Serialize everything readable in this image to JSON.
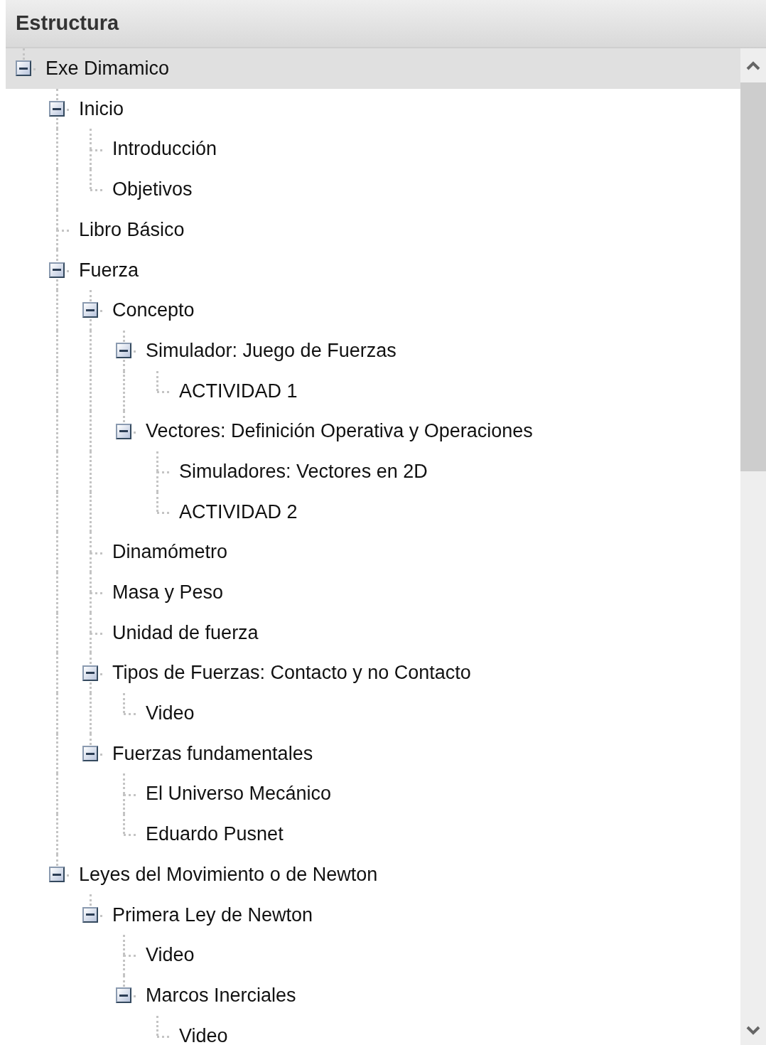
{
  "header": {
    "title": "Estructura"
  },
  "tree": [
    {
      "label": "Exe Dimamico",
      "selected": true,
      "expanded": true,
      "children": [
        {
          "label": "Inicio",
          "selected": false,
          "expanded": true,
          "children": [
            {
              "label": "Introducción",
              "selected": false
            },
            {
              "label": "Objetivos",
              "selected": false
            }
          ]
        },
        {
          "label": "Libro Básico",
          "selected": false
        },
        {
          "label": "Fuerza",
          "selected": false,
          "expanded": true,
          "children": [
            {
              "label": "Concepto",
              "selected": false,
              "expanded": true,
              "children": [
                {
                  "label": "Simulador: Juego de Fuerzas",
                  "selected": false,
                  "expanded": true,
                  "children": [
                    {
                      "label": "ACTIVIDAD 1",
                      "selected": false
                    }
                  ]
                },
                {
                  "label": "Vectores: Definición Operativa y Operaciones",
                  "selected": false,
                  "expanded": true,
                  "children": [
                    {
                      "label": "Simuladores: Vectores en 2D",
                      "selected": false
                    },
                    {
                      "label": "ACTIVIDAD 2",
                      "selected": false
                    }
                  ]
                }
              ]
            },
            {
              "label": "Dinamómetro",
              "selected": false
            },
            {
              "label": "Masa y Peso",
              "selected": false
            },
            {
              "label": "Unidad de fuerza",
              "selected": false
            },
            {
              "label": "Tipos de Fuerzas: Contacto y no Contacto",
              "selected": false,
              "expanded": true,
              "children": [
                {
                  "label": "Video",
                  "selected": false
                }
              ]
            },
            {
              "label": "Fuerzas fundamentales",
              "selected": false,
              "expanded": true,
              "children": [
                {
                  "label": "El Universo Mecánico",
                  "selected": false
                },
                {
                  "label": "Eduardo Pusnet",
                  "selected": false
                }
              ]
            }
          ]
        },
        {
          "label": "Leyes del Movimiento o de Newton",
          "selected": false,
          "expanded": true,
          "children": [
            {
              "label": "Primera Ley de Newton",
              "selected": false,
              "expanded": true,
              "children": [
                {
                  "label": "Video",
                  "selected": false
                },
                {
                  "label": "Marcos Inerciales",
                  "selected": false,
                  "expanded": true,
                  "children": [
                    {
                      "label": "Video",
                      "selected": false
                    }
                  ]
                }
              ]
            }
          ]
        }
      ]
    }
  ]
}
